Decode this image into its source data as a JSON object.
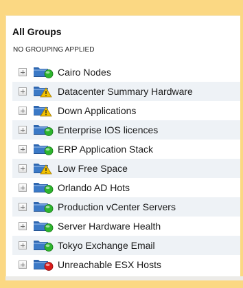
{
  "panel": {
    "title": "All Groups",
    "subtitle": "NO GROUPING APPLIED"
  },
  "colors": {
    "status_up": "#2eb52e",
    "status_warning": "#f2c200",
    "status_down": "#d91c1c",
    "folder": "#3b79c6"
  },
  "groups": [
    {
      "label": "Cairo Nodes",
      "status": "up",
      "icon": "folder-up-icon"
    },
    {
      "label": "Datacenter Summary Hardware",
      "status": "warning",
      "icon": "folder-warning-icon"
    },
    {
      "label": "Down Applications",
      "status": "warning",
      "icon": "folder-warning-icon"
    },
    {
      "label": "Enterprise IOS licences",
      "status": "up",
      "icon": "folder-up-icon"
    },
    {
      "label": "ERP Application Stack",
      "status": "up",
      "icon": "folder-up-icon"
    },
    {
      "label": "Low Free Space",
      "status": "warning",
      "icon": "folder-warning-icon"
    },
    {
      "label": "Orlando AD Hots",
      "status": "up",
      "icon": "folder-up-icon"
    },
    {
      "label": "Production vCenter Servers",
      "status": "up",
      "icon": "folder-up-icon"
    },
    {
      "label": "Server Hardware Health",
      "status": "up",
      "icon": "folder-up-icon"
    },
    {
      "label": "Tokyo Exchange Email",
      "status": "up",
      "icon": "folder-up-icon"
    },
    {
      "label": "Unreachable ESX Hosts",
      "status": "down",
      "icon": "folder-down-icon"
    }
  ]
}
